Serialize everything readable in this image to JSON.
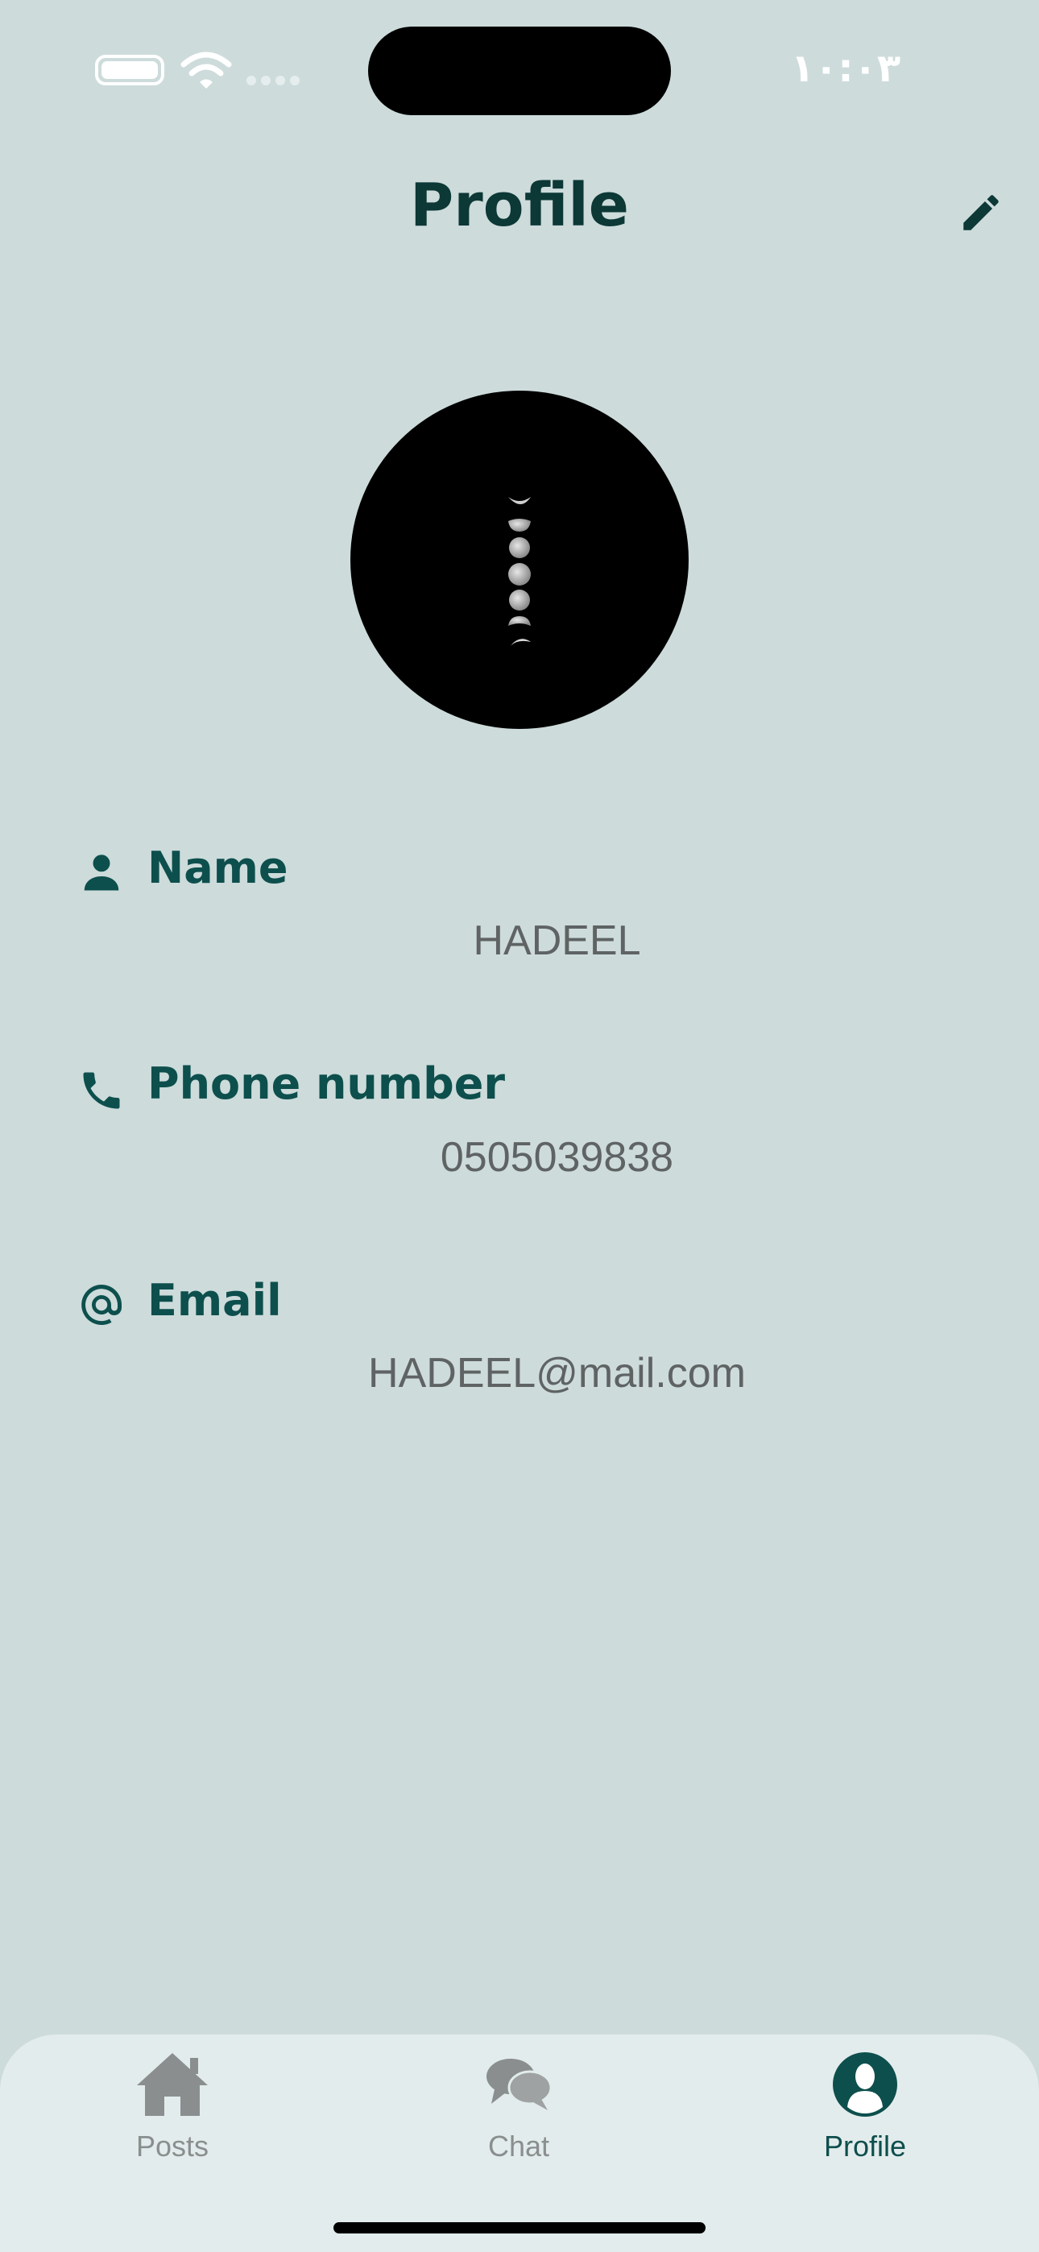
{
  "status_bar": {
    "time": "١٠:٠٣",
    "battery_icon": "battery-icon",
    "wifi_icon": "wifi-icon",
    "signal_icon": "cellular-signal-icon"
  },
  "header": {
    "title": "Profile",
    "edit_icon": "pencil-icon"
  },
  "profile": {
    "avatar": "moon-phases-avatar",
    "fields": [
      {
        "label": "Name",
        "value": "HADEEL",
        "icon": "person-icon"
      },
      {
        "label": "Phone number",
        "value": "0505039838",
        "icon": "phone-icon"
      },
      {
        "label": "Email",
        "value": "HADEEL@mail.com",
        "icon": "at-sign-icon"
      }
    ]
  },
  "tab_bar": {
    "tabs": [
      {
        "label": "Posts",
        "icon": "home-icon",
        "active": false
      },
      {
        "label": "Chat",
        "icon": "chat-bubbles-icon",
        "active": false
      },
      {
        "label": "Profile",
        "icon": "profile-icon",
        "active": true
      }
    ],
    "colors": {
      "active": "#0d4f4d",
      "inactive": "#8a8e8e"
    }
  },
  "colors": {
    "background": "#cddbdb",
    "accent": "#0d4f4d",
    "title": "#0c3836",
    "value_text": "#5f6363"
  }
}
